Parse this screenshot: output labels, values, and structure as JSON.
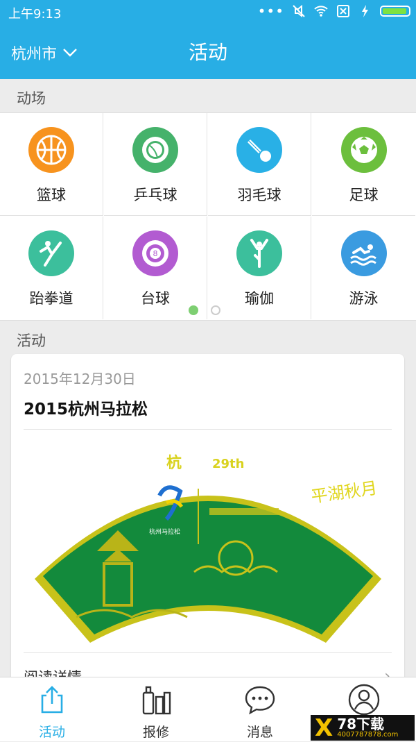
{
  "status_bar": {
    "time": "上午9:13"
  },
  "nav": {
    "city": "杭州市",
    "title": "活动"
  },
  "venues_section": {
    "title": "动场"
  },
  "sports": [
    {
      "label": "篮球",
      "icon": "basketball-icon",
      "color": "#f7931e"
    },
    {
      "label": "乒乓球",
      "icon": "pingpong-icon",
      "color": "#45b26b"
    },
    {
      "label": "羽毛球",
      "icon": "badminton-icon",
      "color": "#29b0e6"
    },
    {
      "label": "足球",
      "icon": "soccer-icon",
      "color": "#6cbf3d"
    },
    {
      "label": "跆拳道",
      "icon": "taekwondo-icon",
      "color": "#3cbf9c"
    },
    {
      "label": "台球",
      "icon": "billiards-icon",
      "color": "#b25bd1"
    },
    {
      "label": "瑜伽",
      "icon": "yoga-icon",
      "color": "#3cbf9c"
    },
    {
      "label": "游泳",
      "icon": "swimming-icon",
      "color": "#3a9be0"
    }
  ],
  "pager": {
    "current": 1,
    "total": 2
  },
  "activities_section": {
    "title": "活动"
  },
  "activity": {
    "date": "2015年12月30日",
    "title": "2015杭州马拉松",
    "banner_text": {
      "edition": "29th",
      "motto": "平湖秋月",
      "brand": "杭州马拉松"
    },
    "more": "阅读详情"
  },
  "tabs": [
    {
      "label": "活动",
      "icon": "share-icon",
      "active": true
    },
    {
      "label": "报修",
      "icon": "repair-bottles-icon",
      "active": false
    },
    {
      "label": "消息",
      "icon": "message-bubble-icon",
      "active": false
    },
    {
      "label": "",
      "icon": "profile-icon",
      "active": false
    }
  ],
  "watermark": {
    "brand": "78下载",
    "site": "4007787878.com"
  },
  "colors": {
    "primary": "#28aee5",
    "active_dot": "#7ecf72",
    "banner_green": "#138a3c",
    "banner_gold": "#c8c21a"
  }
}
